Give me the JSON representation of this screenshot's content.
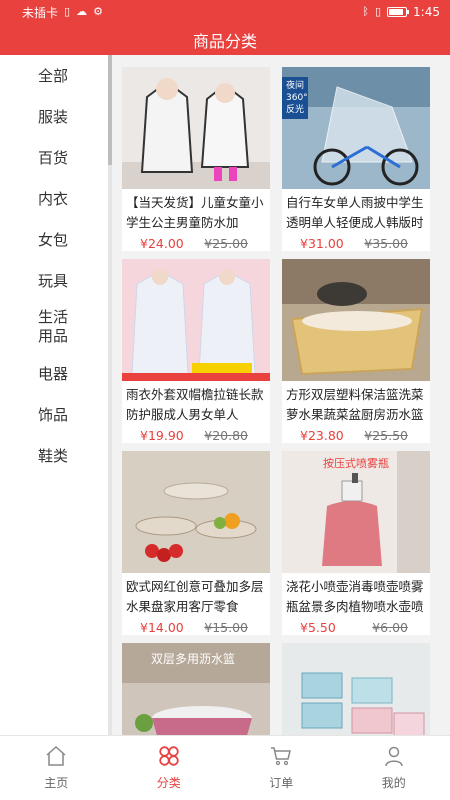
{
  "status": {
    "carrier": "未插卡",
    "time": "1:45"
  },
  "title": "商品分类",
  "sidebar": {
    "items": [
      {
        "label": "全部"
      },
      {
        "label": "服装"
      },
      {
        "label": "百货"
      },
      {
        "label": "内衣"
      },
      {
        "label": "女包"
      },
      {
        "label": "玩具"
      },
      {
        "label": "生活用品"
      },
      {
        "label": "电器"
      },
      {
        "label": "饰品"
      },
      {
        "label": "鞋类"
      }
    ]
  },
  "products": [
    {
      "name": "【当天发货】儿童女童小学生公主男童防水加",
      "price": "¥24.00",
      "old_price": "¥25.00"
    },
    {
      "name": "自行车女单人雨披中学生透明单人轻便成人韩版时",
      "price": "¥31.00",
      "old_price": "¥35.00",
      "badge": "夜间360°反光"
    },
    {
      "name": "雨衣外套双帽檐拉链长款防护服成人男女单人",
      "price": "¥19.90",
      "old_price": "¥20.80"
    },
    {
      "name": "方形双层塑料保洁篮洗菜萝水果蔬菜盆厨房沥水篮",
      "price": "¥23.80",
      "old_price": "¥25.50"
    },
    {
      "name": "欧式网红创意可叠加多层水果盘家用客厅零食",
      "price": "¥14.00",
      "old_price": "¥15.00"
    },
    {
      "name": "浇花小喷壶消毒喷壶喷雾瓶盆景多肉植物喷水壶喷",
      "price": "¥5.50",
      "old_price": "¥6.00",
      "badge": "按压式喷雾瓶"
    },
    {
      "name": "",
      "price": "",
      "old_price": "",
      "badge": "双层多用沥水篮"
    },
    {
      "name": "",
      "price": "",
      "old_price": ""
    }
  ],
  "tabs": [
    {
      "label": "主页",
      "icon": "home-icon"
    },
    {
      "label": "分类",
      "icon": "category-icon"
    },
    {
      "label": "订单",
      "icon": "cart-icon"
    },
    {
      "label": "我的",
      "icon": "profile-icon"
    }
  ],
  "colors": {
    "accent": "#e8413e"
  }
}
